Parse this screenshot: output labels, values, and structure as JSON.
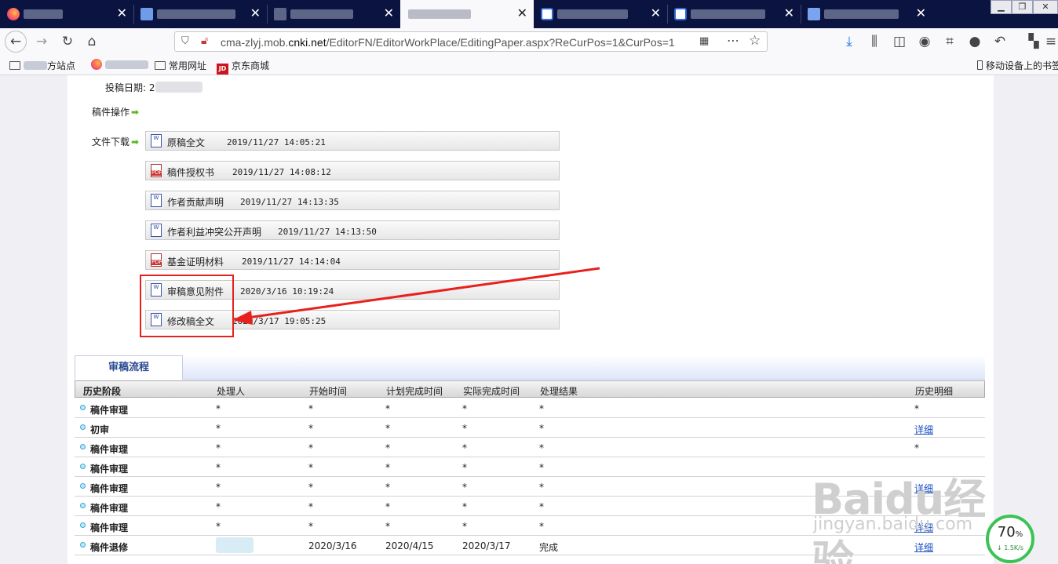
{
  "browser": {
    "tabs": [
      {
        "title": ""
      },
      {
        "title": ""
      },
      {
        "title": ""
      },
      {
        "title": "",
        "active": true
      },
      {
        "title": ""
      },
      {
        "title": ""
      },
      {
        "title": ""
      }
    ],
    "close_glyph": "✕",
    "url": {
      "prefix": "cma-zlyj.mob.",
      "domain": "cnki.net",
      "rest": "/EditorFN/EditorWorkPlace/EditingPaper.aspx?ReCurPos=1&CurPos=1"
    },
    "bookmarks": [
      {
        "label": "方站点"
      },
      {
        "label": ""
      },
      {
        "label": "常用网址"
      },
      {
        "label": "京东商城"
      }
    ],
    "mobile_bookmarks": "移动设备上的书签"
  },
  "paper": {
    "submit_date_label": "投稿日期: 2",
    "operation_label": "稿件操作",
    "download_label": "文件下载",
    "files": [
      {
        "name": "原稿全文",
        "time": "2019/11/27 14:05:21",
        "type": "word"
      },
      {
        "name": "稿件授权书",
        "time": "2019/11/27 14:08:12",
        "type": "pdf"
      },
      {
        "name": "作者贡献声明",
        "time": "2019/11/27 14:13:35",
        "type": "word"
      },
      {
        "name": "作者利益冲突公开声明",
        "time": "2019/11/27 14:13:50",
        "type": "word"
      },
      {
        "name": "基金证明材料",
        "time": "2019/11/27 14:14:04",
        "type": "pdf"
      },
      {
        "name": "审稿意见附件",
        "time": "2020/3/16 10:19:24",
        "type": "word"
      },
      {
        "name": "修改稿全文",
        "time": "2020/3/17 19:05:25",
        "type": "word"
      }
    ]
  },
  "process": {
    "tab_label": "审稿流程",
    "columns": [
      "历史阶段",
      "处理人",
      "开始时间",
      "计划完成时间",
      "实际完成时间",
      "处理结果",
      "历史明细"
    ],
    "rows": [
      {
        "stage": "稿件审理",
        "handler": "*",
        "start": "*",
        "plan": "*",
        "actual": "*",
        "result": "*",
        "detail": "*",
        "link": false
      },
      {
        "stage": "初审",
        "handler": "*",
        "start": "*",
        "plan": "*",
        "actual": "*",
        "result": "*",
        "detail": "详细",
        "link": true
      },
      {
        "stage": "稿件审理",
        "handler": "*",
        "start": "*",
        "plan": "*",
        "actual": "*",
        "result": "*",
        "detail": "*",
        "link": false
      },
      {
        "stage": "稿件审理",
        "handler": "*",
        "start": "*",
        "plan": "*",
        "actual": "*",
        "result": "*",
        "detail": "",
        "link": false
      },
      {
        "stage": "稿件审理",
        "handler": "*",
        "start": "*",
        "plan": "*",
        "actual": "*",
        "result": "*",
        "detail": "详细",
        "link": true
      },
      {
        "stage": "稿件审理",
        "handler": "*",
        "start": "*",
        "plan": "*",
        "actual": "*",
        "result": "*",
        "detail": "",
        "link": false
      },
      {
        "stage": "稿件审理",
        "handler": "*",
        "start": "*",
        "plan": "*",
        "actual": "*",
        "result": "*",
        "detail": "详细",
        "link": true
      },
      {
        "stage": "稿件退修",
        "handler": "",
        "start": "2020/3/16",
        "plan": "2020/4/15",
        "actual": "2020/3/17",
        "result": "完成",
        "detail": "详细",
        "link": true
      }
    ]
  },
  "overlay": {
    "watermark_brand": "Baidu经验",
    "watermark_url": "jingyan.baidu.com",
    "speed_percent": "70",
    "speed_unit": "%",
    "speed_rate": "↓ 1.5K/s"
  }
}
